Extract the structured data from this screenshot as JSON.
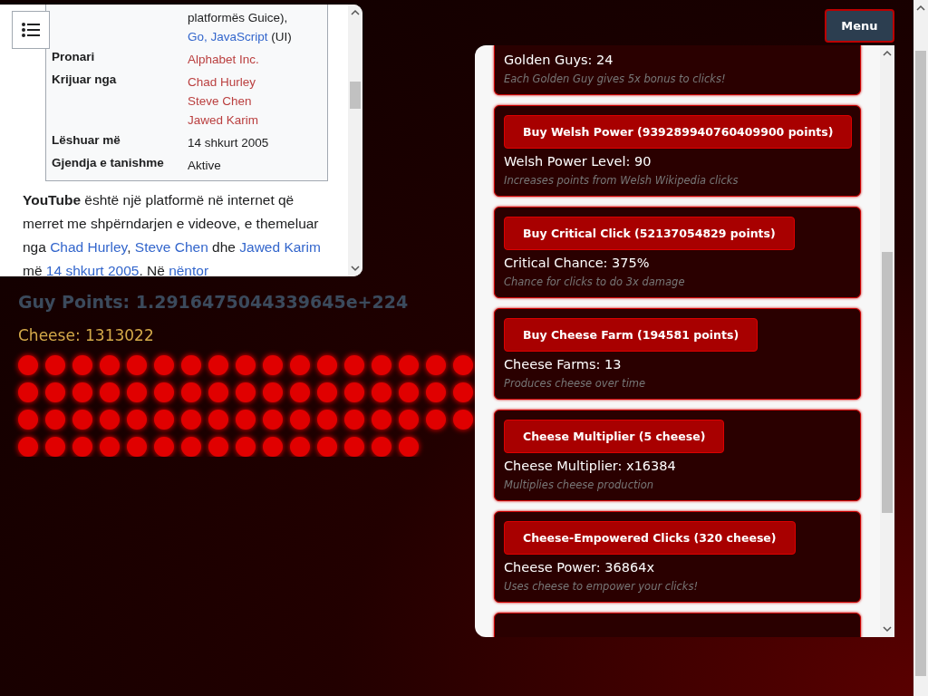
{
  "wiki_panel": {
    "infobox": [
      {
        "lines": [
          [
            {
              "text": "platformës Guice),",
              "kind": "text"
            }
          ],
          [
            {
              "text": "Go, JavaScript",
              "kind": "link"
            },
            {
              "text": " (UI)",
              "kind": "text"
            }
          ]
        ]
      },
      {
        "label": "Pronari",
        "lines": [
          [
            {
              "text": "Alphabet Inc.",
              "kind": "redlink"
            }
          ]
        ]
      },
      {
        "label": "Krijuar nga",
        "lines": [
          [
            {
              "text": "Chad Hurley",
              "kind": "redlink"
            }
          ],
          [
            {
              "text": "Steve Chen",
              "kind": "redlink"
            }
          ],
          [
            {
              "text": "Jawed Karim",
              "kind": "redlink"
            }
          ]
        ]
      },
      {
        "label": "Lëshuar më",
        "lines": [
          [
            {
              "text": "14 shkurt 2005",
              "kind": "text"
            }
          ]
        ]
      },
      {
        "label": "Gjendja e tanishme",
        "lines": [
          [
            {
              "text": "Aktive",
              "kind": "text"
            }
          ]
        ]
      }
    ],
    "paragraph": [
      {
        "text": "YouTube",
        "kind": "bold"
      },
      {
        "text": " është një platformë në internet që merret me shpërndarjen e videove, e themeluar nga ",
        "kind": "text"
      },
      {
        "text": "Chad Hurley",
        "kind": "link"
      },
      {
        "text": ", ",
        "kind": "text"
      },
      {
        "text": "Steve Chen",
        "kind": "link"
      },
      {
        "text": " dhe ",
        "kind": "text"
      },
      {
        "text": "Jawed Karim",
        "kind": "link"
      },
      {
        "text": " më ",
        "kind": "text"
      },
      {
        "text": "14 shkurt 2005",
        "kind": "link"
      },
      {
        "text": ". Në ",
        "kind": "text"
      },
      {
        "text": "nëntor",
        "kind": "link"
      }
    ]
  },
  "guy_points": "Guy Points: 1.2916475044339645e+224",
  "cheese": "Cheese: 1313022",
  "menu_button": "Menu",
  "shop": [
    {
      "stat": "Golden Guys: 24",
      "description": "Each Golden Guy gives 5x bonus to clicks!"
    },
    {
      "button": "Buy Welsh Power (939289940760409900 points)",
      "stat": "Welsh Power Level: 90",
      "description": "Increases points from Welsh Wikipedia clicks"
    },
    {
      "button": "Buy Critical Click (52137054829 points)",
      "stat": "Critical Chance: 375%",
      "description": "Chance for clicks to do 3x damage"
    },
    {
      "button": "Buy Cheese Farm (194581 points)",
      "stat": "Cheese Farms: 13",
      "description": "Produces cheese over time"
    },
    {
      "button": "Cheese Multiplier (5 cheese)",
      "stat": "Cheese Multiplier: x16384",
      "description": "Multiplies cheese production"
    },
    {
      "button": "Cheese-Empowered Clicks (320 cheese)",
      "stat": "Cheese Power: 36864x",
      "description": "Uses cheese to empower your clicks!"
    }
  ]
}
